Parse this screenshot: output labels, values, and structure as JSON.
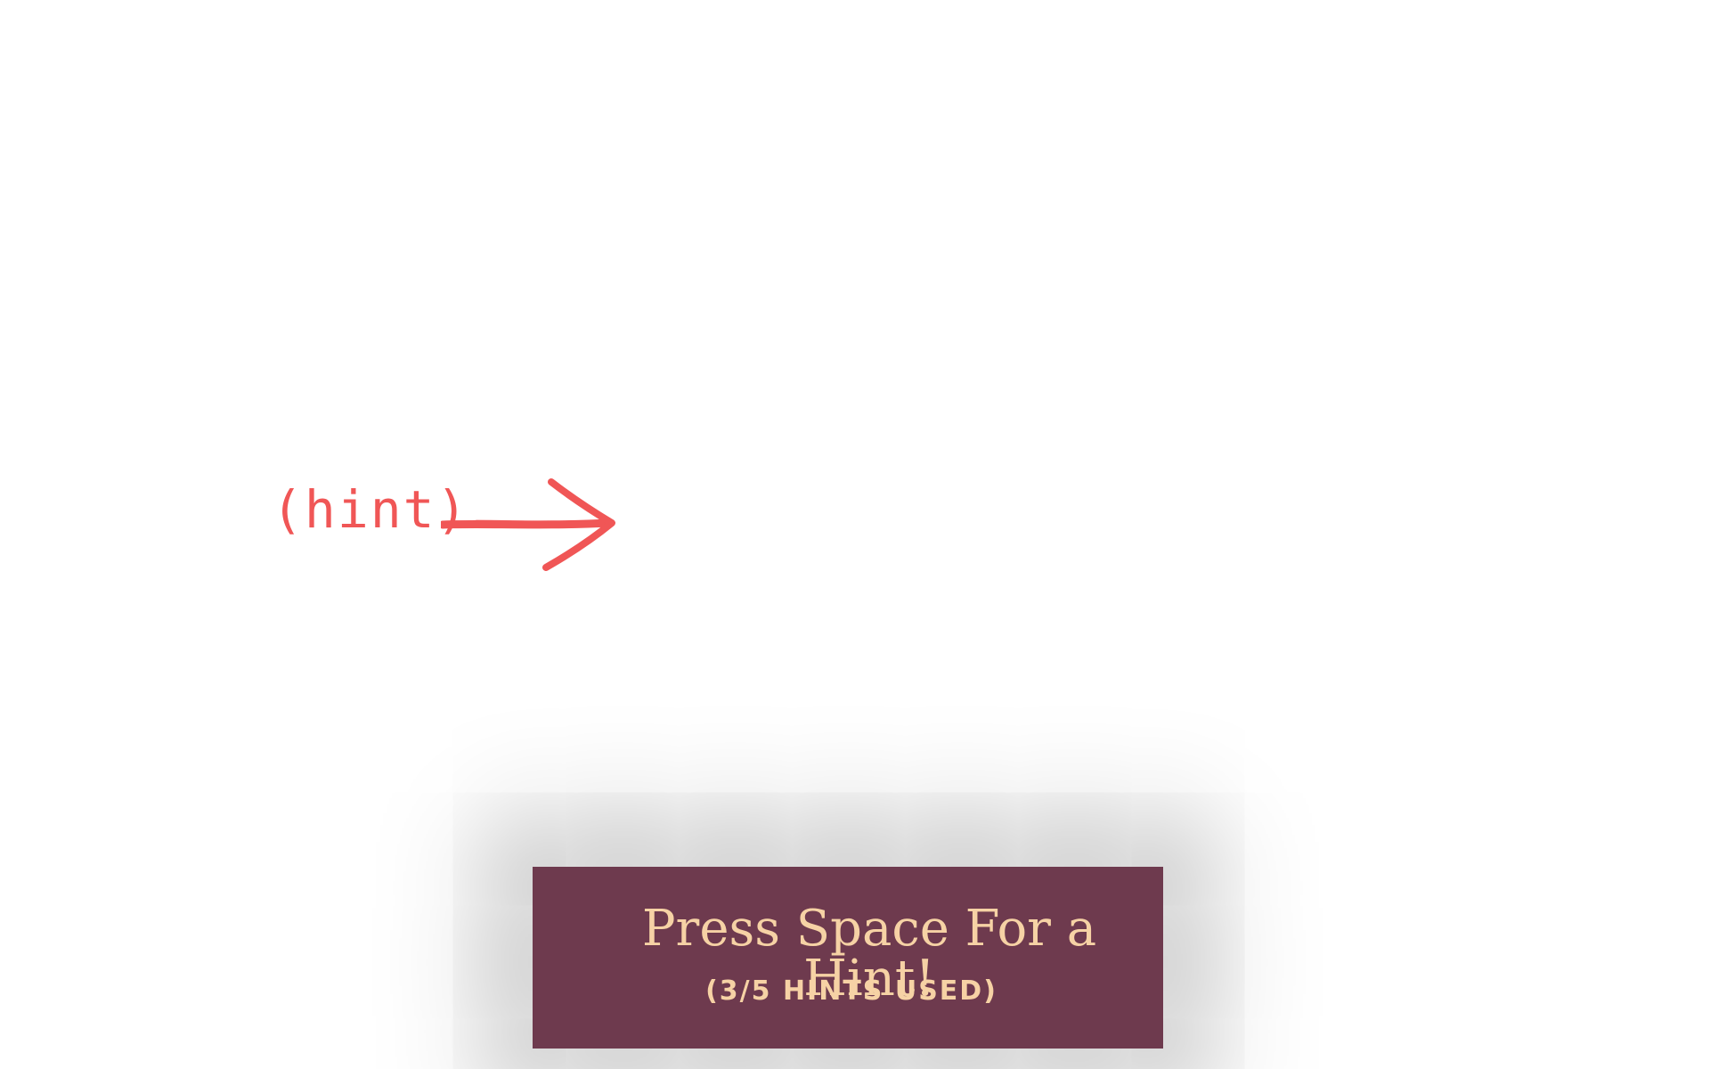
{
  "annotation": {
    "label": "(hint)",
    "icon": "arrow-right-icon",
    "color": "#f05656"
  },
  "hint_panel": {
    "title": "Press Space For a Hint!",
    "count_text": "(3/5 HINTS USED)",
    "hints_used": 3,
    "hints_total": 5,
    "background_color": "#6e3a4e",
    "text_color": "#f6d2a5"
  }
}
